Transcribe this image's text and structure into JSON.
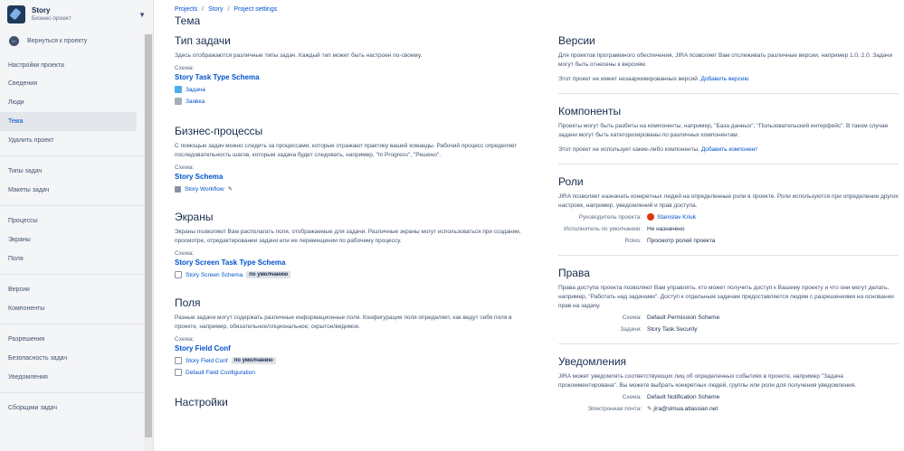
{
  "sidebar": {
    "project_name": "Story",
    "project_type": "Бизнес-проект",
    "back_label": "Вернуться к проекту",
    "section_title": "Настройки проекта",
    "group1": [
      "Сведения",
      "Люди",
      "Тема",
      "Удалить проект"
    ],
    "group2": [
      "Типы задач",
      "Макеты задач"
    ],
    "group3": [
      "Процессы",
      "Экраны",
      "Поля"
    ],
    "group4": [
      "Версии",
      "Компоненты"
    ],
    "group5": [
      "Разрешения",
      "Безопасность задач",
      "Уведомления"
    ],
    "group6": [
      "Сборщики задач"
    ]
  },
  "breadcrumb": [
    "Projects",
    "/",
    "Story",
    "/",
    "Project settings"
  ],
  "page_title": "Тема",
  "issue_types": {
    "title": "Тип задачи",
    "desc": "Здесь отображаются различные типы задач. Каждый тип может быть настроен по-своему.",
    "schema_label": "Схема:",
    "schema_link": "Story Task Type Schema",
    "items": [
      "Задача",
      "Заявка"
    ]
  },
  "workflows": {
    "title": "Бизнес-процессы",
    "desc": "С помощью задач можно следить за процессами, которые отражают практику вашей команды. Рабочий процесс определяет последовательность шагов, которым задача будет следовать, например, \"In Progress\", \"Решено\".",
    "schema_label": "Схема:",
    "schema_link": "Story Schema",
    "workflow": "Story Workflow"
  },
  "screens": {
    "title": "Экраны",
    "desc": "Экраны позволяют Вам располагать поля, отображаемые для задачи. Различные экраны могут использоваться при создании, просмотре, отредактировании задачи или ее перемещении по рабочему процессу.",
    "schema_label": "Схема:",
    "schema_link": "Story Screen Task Type Schema",
    "item": "Story Screen Schema",
    "badge": "по умолчанию"
  },
  "fields": {
    "title": "Поля",
    "desc": "Разные задачи могут содержать различные информационные поля. Конфигурация поля определяет, как ведут себя поля в проекте, например, обязательное/опциональное; скрытое/видимое.",
    "schema_label": "Схема:",
    "schema_link": "Story Field Conf",
    "item1": "Story Field Conf",
    "badge": "по умолчанию",
    "item2": "Default Field Configuration"
  },
  "settings": {
    "title": "Настройки"
  },
  "versions": {
    "title": "Версии",
    "desc": "Для проектов программного обеспечения, JIRA позволяет Вам отслеживать различные версии, например 1.0, 2.0. Задачи могут быть отнесены к версиям.",
    "status": "Этот проект не имеет незаархивированных версий.",
    "action": "Добавить версию"
  },
  "components": {
    "title": "Компоненты",
    "desc": "Проекты могут быть разбиты на компоненты, например, \"База данных\", \"Пользовательский интерфейс\". В таком случае задачи могут быть категоризированы по различных компонентам.",
    "status": "Этот проект не использует какие-либо компоненты.",
    "action": "Добавить компонент"
  },
  "roles": {
    "title": "Роли",
    "desc": "JIRA позволяет назначать конкретных людей на определенные роли в проекте. Роли используются при определении других настроек, например, уведомлений и прав доступа.",
    "lead_label": "Руководитель проекта:",
    "lead_value": "Stanislav Kriuk",
    "assignee_label": "Исполнитель по умолчанию:",
    "assignee_value": "Не назначено",
    "roles_label": "Roles:",
    "roles_value": "Просмотр ролей проекта"
  },
  "permissions": {
    "title": "Права",
    "desc": "Права доступа проекта позволяют Вам управлять, кто может получить доступ к Вашему проекту и что они могут делать, например, \"Работать над задачами\". Доступ к отдельным задачам предоставляется людям с разрешениями на основании прав на задачу.",
    "scheme_label": "Схема:",
    "scheme_value": "Default Permission Scheme",
    "issues_label": "Задачи:",
    "issues_value": "Story Task Security"
  },
  "notifications": {
    "title": "Уведомления",
    "desc": "JIRA может уведомлять соответствующих лиц об определенных событиях в проекте, например \"Задача прокомментирована\". Вы можете выбрать конкретных людей, группы или роли для получения уведомления.",
    "scheme_label": "Схема:",
    "scheme_value": "Default Notification Scheme",
    "email_label": "Электронная почта:",
    "email_value": "jira@slmua.atlassian.net"
  },
  "colors": {
    "accent": "#0052cc",
    "text": "#172b4d",
    "sidebar_bg": "#f4f5f7"
  }
}
